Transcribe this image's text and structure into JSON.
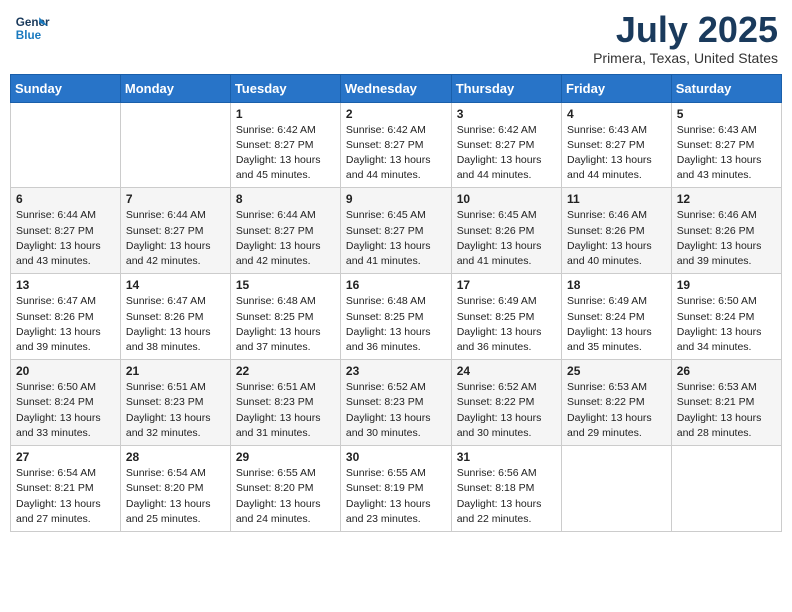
{
  "header": {
    "logo_line1": "General",
    "logo_line2": "Blue",
    "month_title": "July 2025",
    "location": "Primera, Texas, United States"
  },
  "weekdays": [
    "Sunday",
    "Monday",
    "Tuesday",
    "Wednesday",
    "Thursday",
    "Friday",
    "Saturday"
  ],
  "weeks": [
    [
      {
        "day": "",
        "content": ""
      },
      {
        "day": "",
        "content": ""
      },
      {
        "day": "1",
        "content": "Sunrise: 6:42 AM\nSunset: 8:27 PM\nDaylight: 13 hours and 45 minutes."
      },
      {
        "day": "2",
        "content": "Sunrise: 6:42 AM\nSunset: 8:27 PM\nDaylight: 13 hours and 44 minutes."
      },
      {
        "day": "3",
        "content": "Sunrise: 6:42 AM\nSunset: 8:27 PM\nDaylight: 13 hours and 44 minutes."
      },
      {
        "day": "4",
        "content": "Sunrise: 6:43 AM\nSunset: 8:27 PM\nDaylight: 13 hours and 44 minutes."
      },
      {
        "day": "5",
        "content": "Sunrise: 6:43 AM\nSunset: 8:27 PM\nDaylight: 13 hours and 43 minutes."
      }
    ],
    [
      {
        "day": "6",
        "content": "Sunrise: 6:44 AM\nSunset: 8:27 PM\nDaylight: 13 hours and 43 minutes."
      },
      {
        "day": "7",
        "content": "Sunrise: 6:44 AM\nSunset: 8:27 PM\nDaylight: 13 hours and 42 minutes."
      },
      {
        "day": "8",
        "content": "Sunrise: 6:44 AM\nSunset: 8:27 PM\nDaylight: 13 hours and 42 minutes."
      },
      {
        "day": "9",
        "content": "Sunrise: 6:45 AM\nSunset: 8:27 PM\nDaylight: 13 hours and 41 minutes."
      },
      {
        "day": "10",
        "content": "Sunrise: 6:45 AM\nSunset: 8:26 PM\nDaylight: 13 hours and 41 minutes."
      },
      {
        "day": "11",
        "content": "Sunrise: 6:46 AM\nSunset: 8:26 PM\nDaylight: 13 hours and 40 minutes."
      },
      {
        "day": "12",
        "content": "Sunrise: 6:46 AM\nSunset: 8:26 PM\nDaylight: 13 hours and 39 minutes."
      }
    ],
    [
      {
        "day": "13",
        "content": "Sunrise: 6:47 AM\nSunset: 8:26 PM\nDaylight: 13 hours and 39 minutes."
      },
      {
        "day": "14",
        "content": "Sunrise: 6:47 AM\nSunset: 8:26 PM\nDaylight: 13 hours and 38 minutes."
      },
      {
        "day": "15",
        "content": "Sunrise: 6:48 AM\nSunset: 8:25 PM\nDaylight: 13 hours and 37 minutes."
      },
      {
        "day": "16",
        "content": "Sunrise: 6:48 AM\nSunset: 8:25 PM\nDaylight: 13 hours and 36 minutes."
      },
      {
        "day": "17",
        "content": "Sunrise: 6:49 AM\nSunset: 8:25 PM\nDaylight: 13 hours and 36 minutes."
      },
      {
        "day": "18",
        "content": "Sunrise: 6:49 AM\nSunset: 8:24 PM\nDaylight: 13 hours and 35 minutes."
      },
      {
        "day": "19",
        "content": "Sunrise: 6:50 AM\nSunset: 8:24 PM\nDaylight: 13 hours and 34 minutes."
      }
    ],
    [
      {
        "day": "20",
        "content": "Sunrise: 6:50 AM\nSunset: 8:24 PM\nDaylight: 13 hours and 33 minutes."
      },
      {
        "day": "21",
        "content": "Sunrise: 6:51 AM\nSunset: 8:23 PM\nDaylight: 13 hours and 32 minutes."
      },
      {
        "day": "22",
        "content": "Sunrise: 6:51 AM\nSunset: 8:23 PM\nDaylight: 13 hours and 31 minutes."
      },
      {
        "day": "23",
        "content": "Sunrise: 6:52 AM\nSunset: 8:23 PM\nDaylight: 13 hours and 30 minutes."
      },
      {
        "day": "24",
        "content": "Sunrise: 6:52 AM\nSunset: 8:22 PM\nDaylight: 13 hours and 30 minutes."
      },
      {
        "day": "25",
        "content": "Sunrise: 6:53 AM\nSunset: 8:22 PM\nDaylight: 13 hours and 29 minutes."
      },
      {
        "day": "26",
        "content": "Sunrise: 6:53 AM\nSunset: 8:21 PM\nDaylight: 13 hours and 28 minutes."
      }
    ],
    [
      {
        "day": "27",
        "content": "Sunrise: 6:54 AM\nSunset: 8:21 PM\nDaylight: 13 hours and 27 minutes."
      },
      {
        "day": "28",
        "content": "Sunrise: 6:54 AM\nSunset: 8:20 PM\nDaylight: 13 hours and 25 minutes."
      },
      {
        "day": "29",
        "content": "Sunrise: 6:55 AM\nSunset: 8:20 PM\nDaylight: 13 hours and 24 minutes."
      },
      {
        "day": "30",
        "content": "Sunrise: 6:55 AM\nSunset: 8:19 PM\nDaylight: 13 hours and 23 minutes."
      },
      {
        "day": "31",
        "content": "Sunrise: 6:56 AM\nSunset: 8:18 PM\nDaylight: 13 hours and 22 minutes."
      },
      {
        "day": "",
        "content": ""
      },
      {
        "day": "",
        "content": ""
      }
    ]
  ]
}
